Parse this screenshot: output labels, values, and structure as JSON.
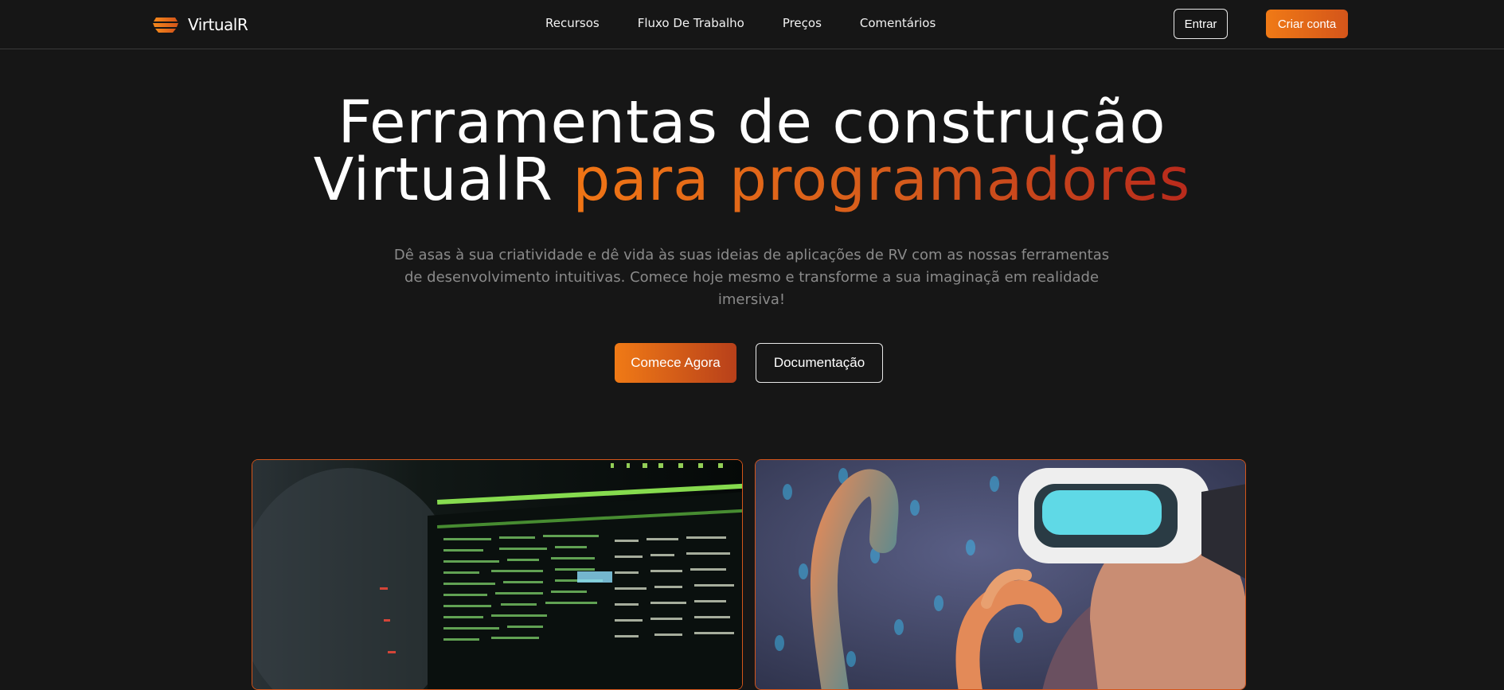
{
  "brand": {
    "name": "VirtualR",
    "accent_color": "#f07515",
    "accent_dark": "#b82a1c"
  },
  "nav": {
    "links": [
      "Recursos",
      "Fluxo De Trabalho",
      "Preços",
      "Comentários"
    ],
    "login_label": "Entrar",
    "signup_label": "Criar conta"
  },
  "hero": {
    "title_line1": "Ferramentas de construção",
    "title_line2_plain": "VirtualR ",
    "title_line2_accent": "para programadores",
    "subtitle": "Dê asas à sua criatividade e dê vida às suas ideias de aplicações de RV com as nossas ferramentas de desenvolvimento intuitivas. Comece hoje mesmo e transforme a sua imaginaçã em realidade imersiva!",
    "primary_cta": "Comece Agora",
    "secondary_cta": "Documentação"
  },
  "images": [
    {
      "icon": "code-terminal-image"
    },
    {
      "icon": "vr-headset-person-image"
    }
  ]
}
